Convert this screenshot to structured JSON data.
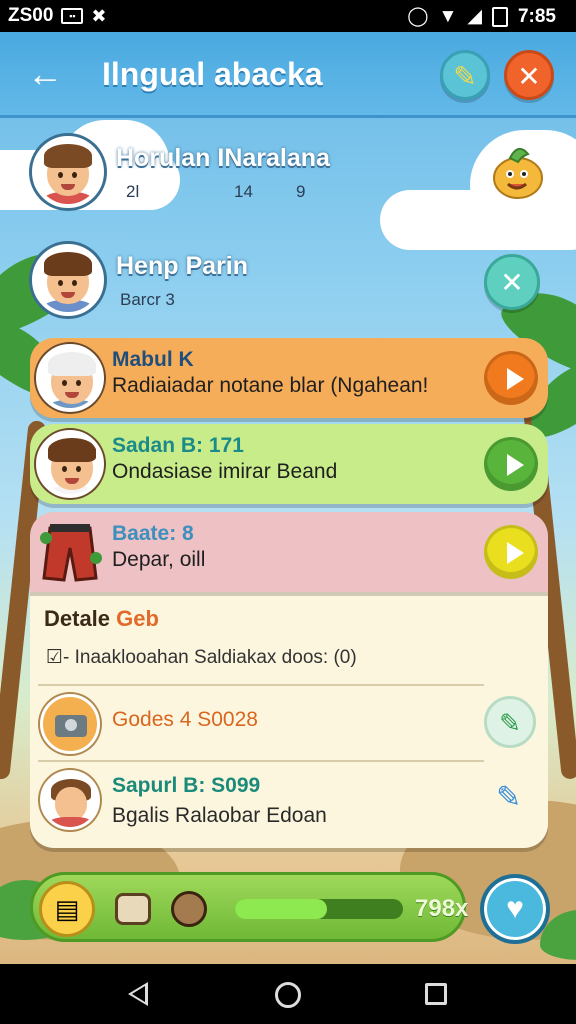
{
  "status_bar": {
    "carrier": "ZS00",
    "time": "7:85"
  },
  "header": {
    "title": "Ilngual abacka",
    "back_icon": "arrow-left-icon",
    "edit_icon": "pencil-icon",
    "close_icon": "close-icon"
  },
  "contacts": [
    {
      "name": "Horulan INaralana",
      "meta_a": "2l",
      "meta_b": "14",
      "meta_c": "9"
    },
    {
      "name": "Henp Parin",
      "meta": "Barcr 3"
    }
  ],
  "cards": [
    {
      "title": "Mabul K",
      "subtitle": "Radiaiadar notane blar (Ngahean!",
      "color": "#f6ad5a",
      "play_color": "#f07a1d",
      "title_color": "#1f4f7a"
    },
    {
      "title": "Sadan B: 171",
      "subtitle": "Ondasiase imirar Beand",
      "color": "#c8ec8a",
      "play_color": "#58b43a",
      "title_color": "#1b8a8a"
    },
    {
      "title": "Baate: 8",
      "subtitle": "Depar, oill",
      "color": "#eec1c4",
      "play_color": "#e9df1e",
      "title_color": "#3d8fbe"
    }
  ],
  "details": {
    "heading": "Detale",
    "heading_accent": "Geb",
    "description": "☑- Inaaklooahan Saldiakax doos: (0)",
    "rows": [
      {
        "title": "Godes 4 S0028",
        "title_color": "#d9661f",
        "action_icon": "pencil-icon"
      },
      {
        "title": "Sapurl B: S099",
        "subtitle": "Bgalis Ralaobar Edoan",
        "title_color": "#1b8a7a",
        "action_icon": "pen-icon"
      }
    ]
  },
  "bottom_bar": {
    "score": "798x",
    "progress_fraction": 0.55,
    "fab_icon": "heart-icon"
  }
}
